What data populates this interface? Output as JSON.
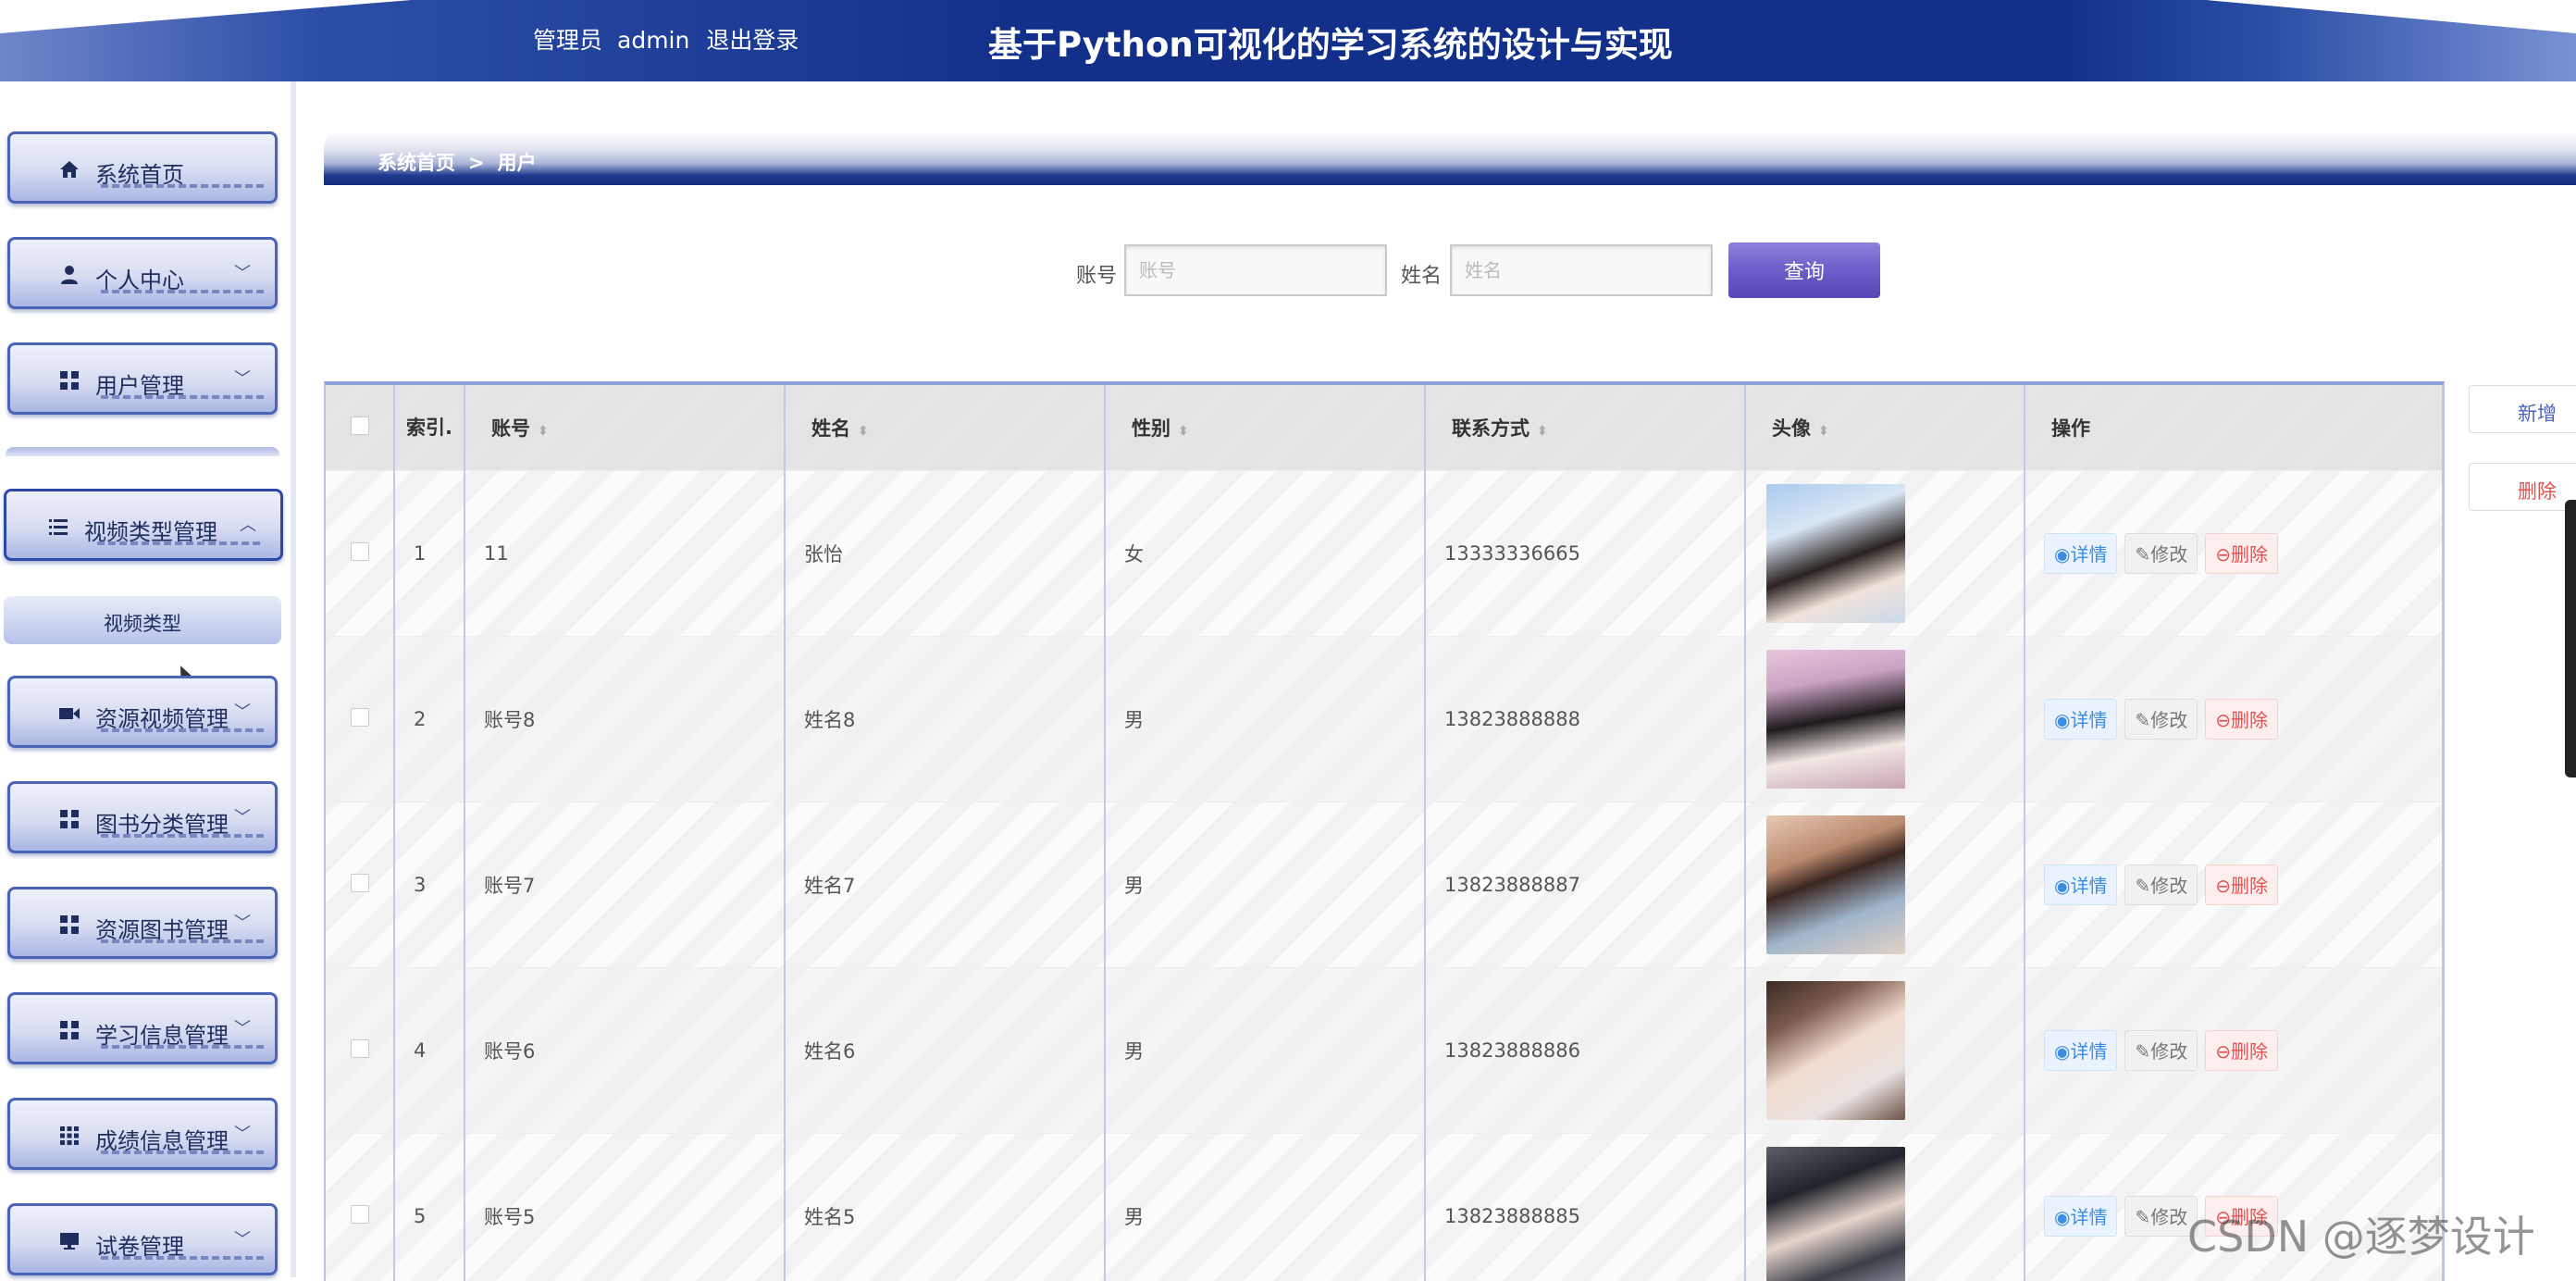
{
  "header": {
    "role": "管理员",
    "username": "admin",
    "logout": "退出登录",
    "title": "基于Python可视化的学习系统的设计与实现"
  },
  "sidebar": {
    "items": [
      {
        "label": "系统首页",
        "icon": "home-icon"
      },
      {
        "label": "个人中心",
        "icon": "user-icon"
      },
      {
        "label": "用户管理",
        "icon": "grid-icon"
      },
      {
        "label": "视频类型管理",
        "icon": "list-icon"
      },
      {
        "label": "资源视频管理",
        "icon": "video-icon"
      },
      {
        "label": "图书分类管理",
        "icon": "grid-icon"
      },
      {
        "label": "资源图书管理",
        "icon": "grid-icon"
      },
      {
        "label": "学习信息管理",
        "icon": "grid-icon"
      },
      {
        "label": "成绩信息管理",
        "icon": "apps-icon"
      },
      {
        "label": "试卷管理",
        "icon": "monitor-icon"
      }
    ],
    "submenu_item": "视频类型"
  },
  "breadcrumb": {
    "home": "系统首页",
    "separator": ">",
    "current": "用户"
  },
  "search": {
    "account_label": "账号",
    "account_placeholder": "账号",
    "account_value": "",
    "name_label": "姓名",
    "name_placeholder": "姓名",
    "name_value": "",
    "query_button": "查询"
  },
  "side_actions": {
    "add": "新增",
    "delete": "删除"
  },
  "table": {
    "headers": {
      "index": "索引.",
      "account": "账号",
      "name": "姓名",
      "gender": "性别",
      "phone": "联系方式",
      "avatar": "头像",
      "ops": "操作"
    },
    "actions": {
      "detail": "详情",
      "edit": "修改",
      "delete": "删除"
    },
    "rows": [
      {
        "index": "1",
        "account": "11",
        "name": "张怡",
        "gender": "女",
        "phone": "13333336665"
      },
      {
        "index": "2",
        "account": "账号8",
        "name": "姓名8",
        "gender": "男",
        "phone": "13823888888"
      },
      {
        "index": "3",
        "account": "账号7",
        "name": "姓名7",
        "gender": "男",
        "phone": "13823888887"
      },
      {
        "index": "4",
        "account": "账号6",
        "name": "姓名6",
        "gender": "男",
        "phone": "13823888886"
      },
      {
        "index": "5",
        "account": "账号5",
        "name": "姓名5",
        "gender": "男",
        "phone": "13823888885"
      }
    ]
  },
  "watermark": "CSDN @逐梦设计"
}
